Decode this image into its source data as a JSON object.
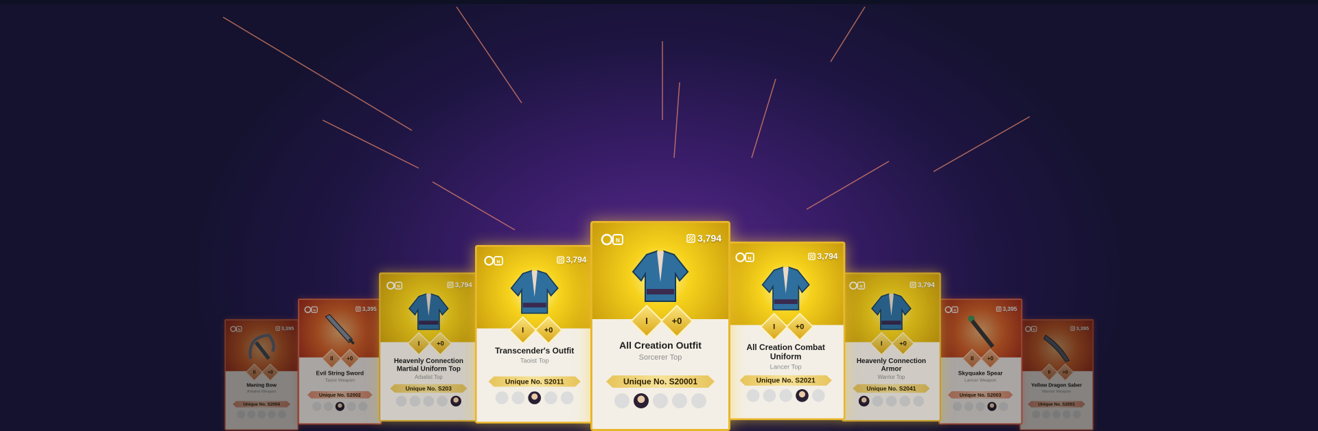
{
  "colors": {
    "background": "#2a1850",
    "gold_frame": "#e8b62a",
    "red_frame": "#e85a3a"
  },
  "cards": [
    {
      "name": "Maning Bow",
      "type": "Arbalist Weapon",
      "unique": "Unique No. S2004",
      "price": "3,395",
      "grade": "II",
      "enhance": "+0",
      "rarity": "red",
      "item_icon": "bow-icon"
    },
    {
      "name": "Evil String Sword",
      "type": "Taoist Weapon",
      "unique": "Unique No. S2002",
      "price": "3,395",
      "grade": "II",
      "enhance": "+0",
      "rarity": "red",
      "item_icon": "sword-icon"
    },
    {
      "name": "Heavenly Connection Martial Uniform Top",
      "type": "Arbalist Top",
      "unique": "Unique No. S203",
      "price": "3,794",
      "grade": "I",
      "enhance": "+0",
      "rarity": "gold",
      "item_icon": "armor-icon"
    },
    {
      "name": "Transcender's Outfit",
      "type": "Taoist Top",
      "unique": "Unique No. S2011",
      "price": "3,794",
      "grade": "I",
      "enhance": "+0",
      "rarity": "gold",
      "item_icon": "armor-icon"
    },
    {
      "name": "All Creation Outfit",
      "type": "Sorcerer Top",
      "unique": "Unique No. S20001",
      "price": "3,794",
      "grade": "I",
      "enhance": "+0",
      "rarity": "gold",
      "item_icon": "armor-icon"
    },
    {
      "name": "All Creation Combat Uniform",
      "type": "Lancer Top",
      "unique": "Unique No. S2021",
      "price": "3,794",
      "grade": "I",
      "enhance": "+0",
      "rarity": "gold",
      "item_icon": "armor-icon"
    },
    {
      "name": "Heavenly Connection Armor",
      "type": "Warrior Top",
      "unique": "Unique No. S2041",
      "price": "3,794",
      "grade": "I",
      "enhance": "+0",
      "rarity": "gold",
      "item_icon": "armor-icon"
    },
    {
      "name": "Skyquake Spear",
      "type": "Lancer Weapon",
      "unique": "Unique No. S2003",
      "price": "3,395",
      "grade": "II",
      "enhance": "+0",
      "rarity": "red",
      "item_icon": "spear-icon"
    },
    {
      "name": "Yellow Dragon Saber",
      "type": "Warrior Weapon",
      "unique": "Unique No. S2001",
      "price": "3,395",
      "grade": "II",
      "enhance": "+0",
      "rarity": "red",
      "item_icon": "saber-icon"
    }
  ]
}
